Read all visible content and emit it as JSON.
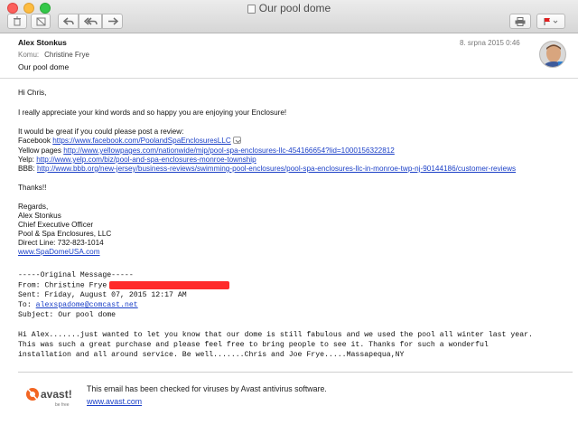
{
  "window": {
    "title": "Our pool dome"
  },
  "header": {
    "from_name": "Alex Stonkus",
    "to_label": "Komu:",
    "to_value": "Christine Frye",
    "subject": "Our pool dome",
    "date": "8. srpna 2015 0:46"
  },
  "body": {
    "greeting": "Hi Chris,",
    "line1": "I really appreciate your kind words and so happy you are enjoying your Enclosure!",
    "review_intro": "It would be great if you could please post a review:",
    "reviews": [
      {
        "label": "Facebook",
        "url": "https://www.facebook.com/PoolandSpaEnclosuresLLC"
      },
      {
        "label": "Yellow pages",
        "url": "http://www.yellowpages.com/nationwide/mip/pool-spa-enclosures-llc-454166654?lid=1000156322812"
      },
      {
        "label": "Yelp:",
        "url": "http://www.yelp.com/biz/pool-and-spa-enclosures-monroe-township"
      },
      {
        "label": "BBB:",
        "url": "http://www.bbb.org/new-jersey/business-reviews/swimming-pool-enclosures/pool-spa-enclosures-llc-in-monroe-twp-nj-90144186/customer-reviews"
      }
    ],
    "thanks": "Thanks!!",
    "signature": {
      "regards": "Regards,",
      "name": "Alex Stonkus",
      "role": "Chief Executive Officer",
      "company": "Pool & Spa Enclosures, LLC",
      "phone": "Direct Line: 732-823-1014",
      "website": "www.SpaDomeUSA.com"
    }
  },
  "original": {
    "separator": "-----Original Message-----",
    "from_label": "From: Christine Frye",
    "sent": "Sent: Friday, August 07, 2015 12:17 AM",
    "to_label": "To:",
    "to_email": "alexspadome@comcast.net",
    "subject": "Subject: Our pool dome",
    "text_line1": "Hi Alex.......just wanted to let you know that our dome is still fabulous and we used the pool all winter last year.",
    "text_line2": "This was such a great purchase and please feel free to bring people to see it.      Thanks for such a wonderful",
    "text_line3": "installation and all around service. Be well.......Chris and Joe Frye.....Massapequa,NY"
  },
  "avast": {
    "brand": "avast!",
    "tagline": "be free",
    "message": "This email has been checked for viruses by Avast antivirus software.",
    "link": "www.avast.com"
  },
  "colors": {
    "link": "#1a3fc7",
    "redaction": "#ff2a2a",
    "avast_orange": "#f26522"
  }
}
